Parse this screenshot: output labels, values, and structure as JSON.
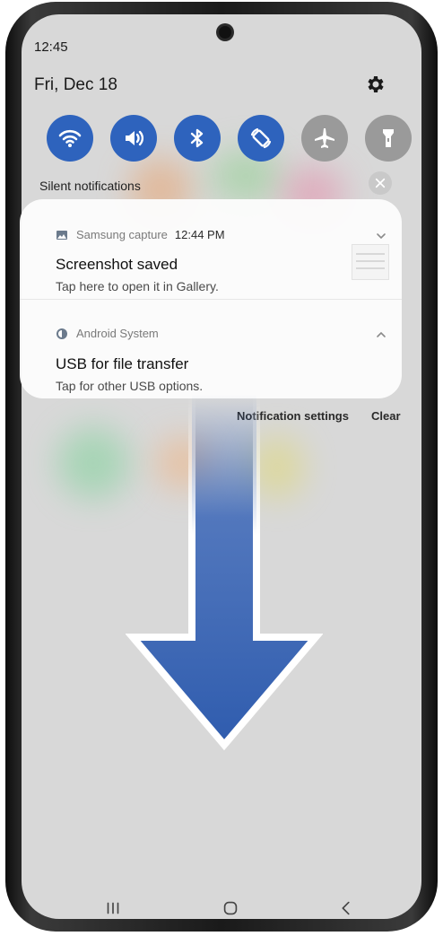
{
  "status": {
    "time": "12:45",
    "date": "Fri, Dec 18"
  },
  "quick_settings": [
    {
      "name": "wifi",
      "state": "on"
    },
    {
      "name": "sound",
      "state": "on"
    },
    {
      "name": "bluetooth",
      "state": "on"
    },
    {
      "name": "auto-rotate",
      "state": "on"
    },
    {
      "name": "airplane-mode",
      "state": "off"
    },
    {
      "name": "flashlight",
      "state": "off"
    }
  ],
  "section": {
    "label": "Silent notifications"
  },
  "notifications": [
    {
      "app": "Samsung capture",
      "time": "12:44 PM",
      "title": "Screenshot saved",
      "body": "Tap here to open it in Gallery."
    },
    {
      "app": "Android System",
      "time": "",
      "title": "USB for file transfer",
      "body": "Tap for other USB options."
    }
  ],
  "actions": {
    "settings": "Notification settings",
    "clear": "Clear"
  },
  "colors": {
    "accent": "#2e63bd",
    "arrow": "#3a66b8",
    "inactive": "#9a9a9a"
  }
}
